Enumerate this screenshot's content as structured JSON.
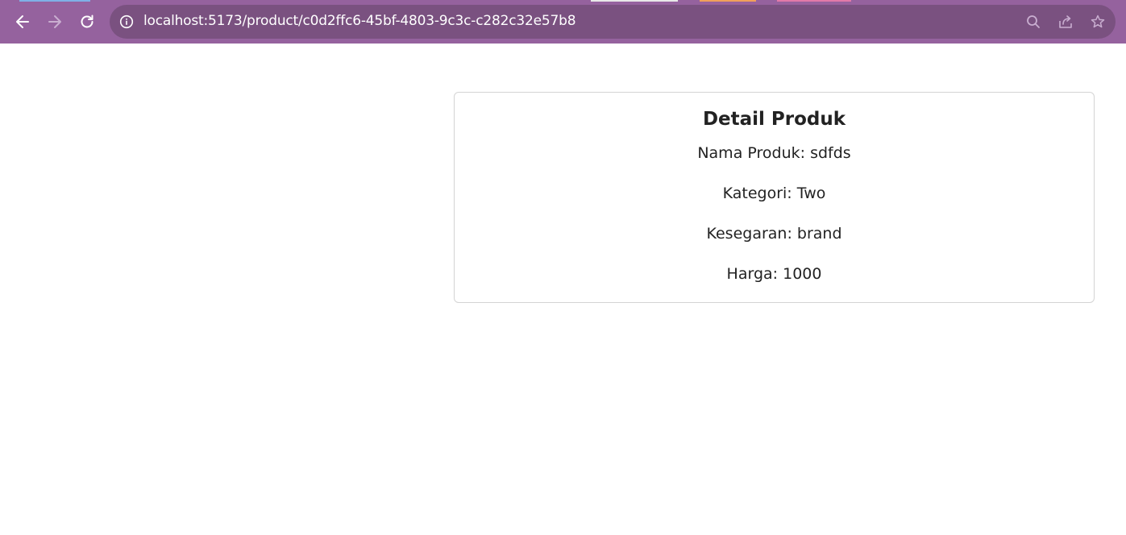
{
  "browser": {
    "url": "localhost:5173/product/c0d2ffc6-45bf-4803-9c3c-c282c32e57b8",
    "icons": {
      "back": "arrow-left-icon",
      "forward": "arrow-right-icon",
      "reload": "reload-icon",
      "site_info": "info-icon",
      "search": "search-icon",
      "share": "share-icon",
      "bookmark": "star-icon"
    },
    "colors": {
      "toolbar": "#95629e",
      "omnibox": "#7a5180"
    }
  },
  "product_detail": {
    "title": "Detail Produk",
    "name_line": "Nama Produk: sdfds",
    "category_line": "Kategori: Two",
    "freshness_line": "Kesegaran: brand",
    "price_line": "Harga: 1000"
  }
}
